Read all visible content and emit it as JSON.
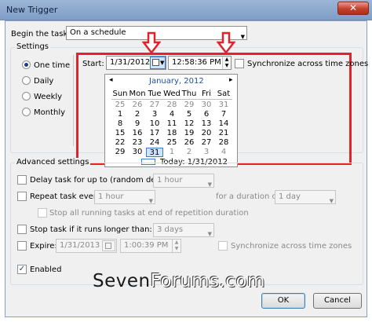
{
  "window": {
    "title": "New Trigger",
    "close_glyph": "✕"
  },
  "begin": {
    "label": "Begin the task:",
    "value": "On a schedule"
  },
  "settings": {
    "label": "Settings"
  },
  "schedule": {
    "options": [
      {
        "label": "One time",
        "selected": true
      },
      {
        "label": "Daily",
        "selected": false
      },
      {
        "label": "Weekly",
        "selected": false
      },
      {
        "label": "Monthly",
        "selected": false
      }
    ],
    "start_label": "Start:",
    "start_date": "1/31/2012",
    "start_time": "12:58:36 PM",
    "sync_label": "Synchronize across time zones"
  },
  "calendar": {
    "month": "January, 2012",
    "prev": "◂",
    "next": "▸",
    "weekdays": [
      "Sun",
      "Mon",
      "Tue",
      "Wed",
      "Thu",
      "Fri",
      "Sat"
    ],
    "days": [
      [
        "25",
        "26",
        "27",
        "28",
        "29",
        "30",
        "31"
      ],
      [
        "1",
        "2",
        "3",
        "4",
        "5",
        "6",
        "7"
      ],
      [
        "8",
        "9",
        "10",
        "11",
        "12",
        "13",
        "14"
      ],
      [
        "15",
        "16",
        "17",
        "18",
        "19",
        "20",
        "21"
      ],
      [
        "22",
        "23",
        "24",
        "25",
        "26",
        "27",
        "28"
      ],
      [
        "29",
        "30",
        "31",
        "1",
        "2",
        "3",
        "4"
      ]
    ],
    "today_label": "Today: 1/31/2012"
  },
  "advanced": {
    "label": "Advanced settings",
    "delay_label": "Delay task for up to (random delay):",
    "delay_value": "1 hour",
    "repeat_label": "Repeat task every:",
    "repeat_value": "1 hour",
    "duration_label": "for a duration of:",
    "duration_value": "1 day",
    "stop_running_label": "Stop all running tasks at end of repetition duration",
    "stop_longer_label": "Stop task if it runs longer than:",
    "stop_longer_value": "3 days",
    "expire_label": "Expire:",
    "expire_date": "1/31/2013",
    "expire_time": "1:00:39 PM",
    "expire_sync_label": "Synchronize across time zones",
    "enabled_label": "Enabled",
    "enabled": true
  },
  "buttons": {
    "ok": "OK",
    "cancel": "Cancel"
  },
  "watermark": {
    "part1": "Seven",
    "part2": "Forums.com"
  },
  "colors": {
    "highlight": "#e3222a",
    "accent": "#1e3a8a"
  }
}
